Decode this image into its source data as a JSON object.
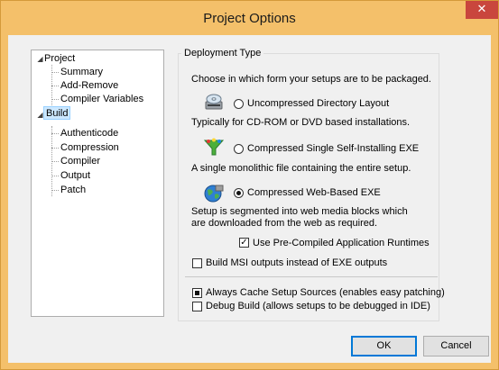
{
  "window": {
    "title": "Project Options",
    "close_glyph": "✕"
  },
  "tree": {
    "nodes": [
      {
        "label": "Project",
        "expander": "◢"
      },
      {
        "label": "Summary"
      },
      {
        "label": "Add-Remove"
      },
      {
        "label": "Compiler Variables"
      },
      {
        "label": "Build",
        "expander": "◢",
        "selected": true
      },
      {
        "label": "Authenticode"
      },
      {
        "label": "Compression"
      },
      {
        "label": "Compiler"
      },
      {
        "label": "Output"
      },
      {
        "label": "Patch"
      }
    ]
  },
  "deployment": {
    "group_title": "Deployment Type",
    "intro": "Choose in which form your setups are to be packaged.",
    "options": [
      {
        "icon": "cd-drive-icon",
        "label": "Uncompressed Directory Layout",
        "mnemonic": "U",
        "selected": false,
        "description": "Typically for CD-ROM or DVD based installations."
      },
      {
        "icon": "funnel-icon",
        "label": "Compressed Single Self-Installing EXE",
        "mnemonic": "C",
        "selected": false,
        "description": "A single monolithic file containing the entire setup."
      },
      {
        "icon": "globe-icon",
        "label": "Compressed Web-Based EXE",
        "mnemonic": "W",
        "selected": true,
        "description_line1": "Setup is segmented into web media blocks which",
        "description_line2": "are downloaded from the web as required."
      }
    ],
    "precompiled_runtimes": {
      "label": "Use Pre-Compiled Application Runtimes",
      "checked": true
    },
    "build_msi": {
      "label": "Build MSI outputs instead of EXE outputs",
      "checked": false
    },
    "always_cache": {
      "label": "Always Cache Setup Sources (enables easy patching)",
      "state": "indeterminate"
    },
    "debug_build": {
      "label": "Debug Build (allows setups to be debugged in IDE)",
      "checked": false
    }
  },
  "buttons": {
    "ok": "OK",
    "cancel": "Cancel"
  },
  "colors": {
    "titlebar": "#f4c06a",
    "close": "#c9463d",
    "selection": "#cce8ff"
  }
}
